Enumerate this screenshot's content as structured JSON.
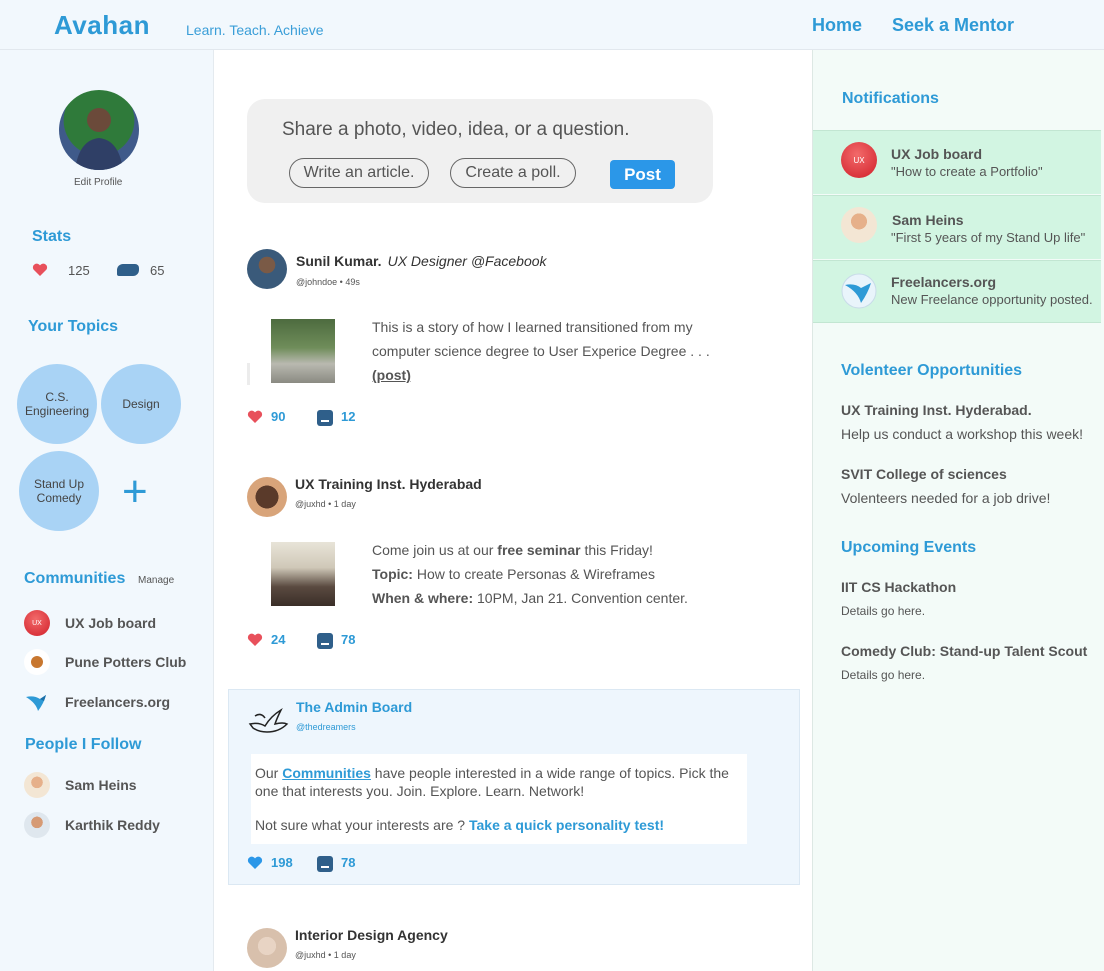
{
  "header": {
    "brand": "Avahan",
    "tagline": "Learn. Teach. Achieve",
    "nav": [
      "Home",
      "Seek a Mentor"
    ]
  },
  "profile": {
    "edit_label": "Edit Profile"
  },
  "stats": {
    "title": "Stats",
    "likes": "125",
    "comments": "65"
  },
  "topics": {
    "title": "Your Topics",
    "items": [
      "C.S. Engineering",
      "Design",
      "Stand Up Comedy"
    ],
    "add_label": "+"
  },
  "communities": {
    "title": "Communities",
    "manage_label": "Manage",
    "items": [
      {
        "label": "UX Job board",
        "icon": "ux-logo-icon"
      },
      {
        "label": "Pune Potters Club",
        "icon": "pot-icon"
      },
      {
        "label": "Freelancers.org",
        "icon": "bird-logo-icon"
      }
    ]
  },
  "people": {
    "title": "People I Follow",
    "items": [
      {
        "label": "Sam Heins"
      },
      {
        "label": "Karthik Reddy"
      }
    ]
  },
  "composer": {
    "prompt": "Share a photo, video, idea, or a question.",
    "article_label": "Write an article.",
    "poll_label": "Create a poll.",
    "post_label": "Post"
  },
  "posts": [
    {
      "author": "Sunil Kumar.",
      "role": "UX Designer @Facebook",
      "handle": "@johndoe • 49s",
      "text": "This is a story of how I learned transitioned from my computer science degree to User Experice Degree . . .",
      "link": "(post)",
      "likes": "90",
      "comments": "12"
    },
    {
      "author": "UX Training Inst. Hyderabad",
      "handle": "@juxhd • 1 day",
      "intro": "Come join us at our ",
      "intro_bold": "free seminar",
      "intro_end": " this Friday!",
      "topic_label": "Topic:",
      "topic_value": " How to create Personas & Wireframes",
      "when_label": "When & where:",
      "when_value": " 10PM, Jan 21. Convention center.",
      "likes": "24",
      "comments": "78"
    },
    {
      "author": "The Admin Board",
      "handle": "@thedreamers",
      "line1_start": "Our ",
      "line1_link": "Communities",
      "line1_end": " have  people interested in a wide range of topics. Pick the one that interests you. Join. Explore. Learn. Network!",
      "line2_start": "Not sure what your interests are ? ",
      "line2_link": "Take a  quick personality test!",
      "likes": "198",
      "comments": "78"
    },
    {
      "author": "Interior Design Agency",
      "handle": "@juxhd • 1 day"
    }
  ],
  "notifications": {
    "title": "Notifications",
    "items": [
      {
        "title": "UX Job board",
        "sub": "\"How to create a Portfolio\""
      },
      {
        "title": "Sam Heins",
        "sub": "\"First 5 years of my Stand Up life\""
      },
      {
        "title": "Freelancers.org",
        "sub": "New Freelance opportunity posted."
      }
    ]
  },
  "volunteer": {
    "title": "Volenteer Opportunities",
    "items": [
      {
        "title": "UX Training Inst. Hyderabad.",
        "desc": "Help us conduct a workshop this week!"
      },
      {
        "title": "SVIT College of sciences",
        "desc": "Volenteers needed for a job drive!"
      }
    ]
  },
  "events": {
    "title": "Upcoming Events",
    "items": [
      {
        "title": "IIT CS Hackathon",
        "desc": "Details go here."
      },
      {
        "title": "Comedy Club: Stand-up Talent Scout",
        "desc": "Details go here."
      }
    ]
  },
  "icon_text": {
    "ux_logo": "UX"
  },
  "colors": {
    "accent": "#2e9ad6",
    "post_button": "#2b97e8",
    "heart": "#e8505b",
    "heart_admin": "#2b97e8",
    "comment_icon": "#2f5f8a",
    "notification_bg": "#d2f5e2",
    "topic_bubble": "#a9d3f5"
  }
}
